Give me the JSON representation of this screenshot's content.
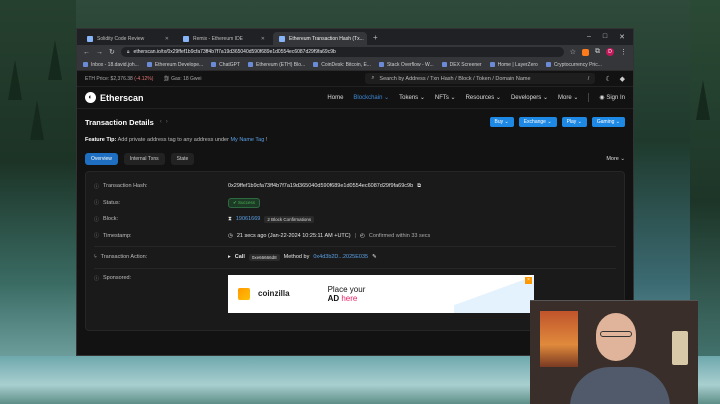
{
  "browser": {
    "tabs": [
      {
        "title": "Solidity Code Review",
        "active": false
      },
      {
        "title": "Remix - Ethereum IDE",
        "active": false
      },
      {
        "title": "Ethereum Transaction Hash (Tx...",
        "active": true
      }
    ],
    "url": "etherscan.io/tx/0x29ffef1b9cfa73ff4b7f7a19d365040d590f689e1d0554ec6087d29f9fa69c9b",
    "bookmarks": [
      "Inbox - 18.david.joh...",
      "Ethereum Develope...",
      "ChatGPT",
      "Ethereum (ETH) Blo...",
      "CoinDesk: Bitcoin, E...",
      "Stack Overflow - W...",
      "DEX Screener",
      "Home | LayerZero",
      "Cryptocurrency Pric..."
    ],
    "profile_initial": "D"
  },
  "topbar": {
    "eth_price_label": "ETH Price: $2,376.38",
    "eth_change": "(-4.12%)",
    "gas": "Gas: 18 Gwei",
    "search_placeholder": "Search by Address / Txn Hash / Block / Token / Domain Name",
    "slash": "/"
  },
  "nav": {
    "logo": "Etherscan",
    "items": [
      "Home",
      "Blockchain",
      "Tokens",
      "NFTs",
      "Resources",
      "Developers",
      "More"
    ],
    "active": "Blockchain",
    "sign_in": "Sign In"
  },
  "page": {
    "title": "Transaction Details",
    "action_buttons": [
      "Buy",
      "Exchange",
      "Play",
      "Gaming"
    ],
    "feature_tip_label": "Feature Tip:",
    "feature_tip_text": "Add private address tag to any address under",
    "feature_tip_link": "My Name Tag",
    "feature_tip_end": "!",
    "subtabs": [
      "Overview",
      "Internal Txns",
      "State"
    ],
    "more": "More"
  },
  "details": {
    "hash_label": "Transaction Hash:",
    "hash_value": "0x29ffef1b9cfa73ff4b7f7a19d365040d590f689e1d0554ec6087d29f9fa69c9b",
    "status_label": "Status:",
    "status_value": "Success",
    "block_label": "Block:",
    "block_value": "19061669",
    "block_confirmations": "2 Block Confirmations",
    "timestamp_label": "Timestamp:",
    "timestamp_value": "21 secs ago (Jan-22-2024 10:25:11 AM +UTC)",
    "confirmed_within": "Confirmed within 33 secs",
    "action_label": "Transaction Action:",
    "action_call": "Call",
    "action_hex": "0xe66666d8",
    "action_method_label": "Method by",
    "action_method_addr": "0x4d3b2D...2025E035",
    "sponsored_label": "Sponsored:"
  },
  "ad": {
    "brand": "coinzilla",
    "line1": "Place your",
    "line2_ad": "AD",
    "line2_here": "here"
  }
}
